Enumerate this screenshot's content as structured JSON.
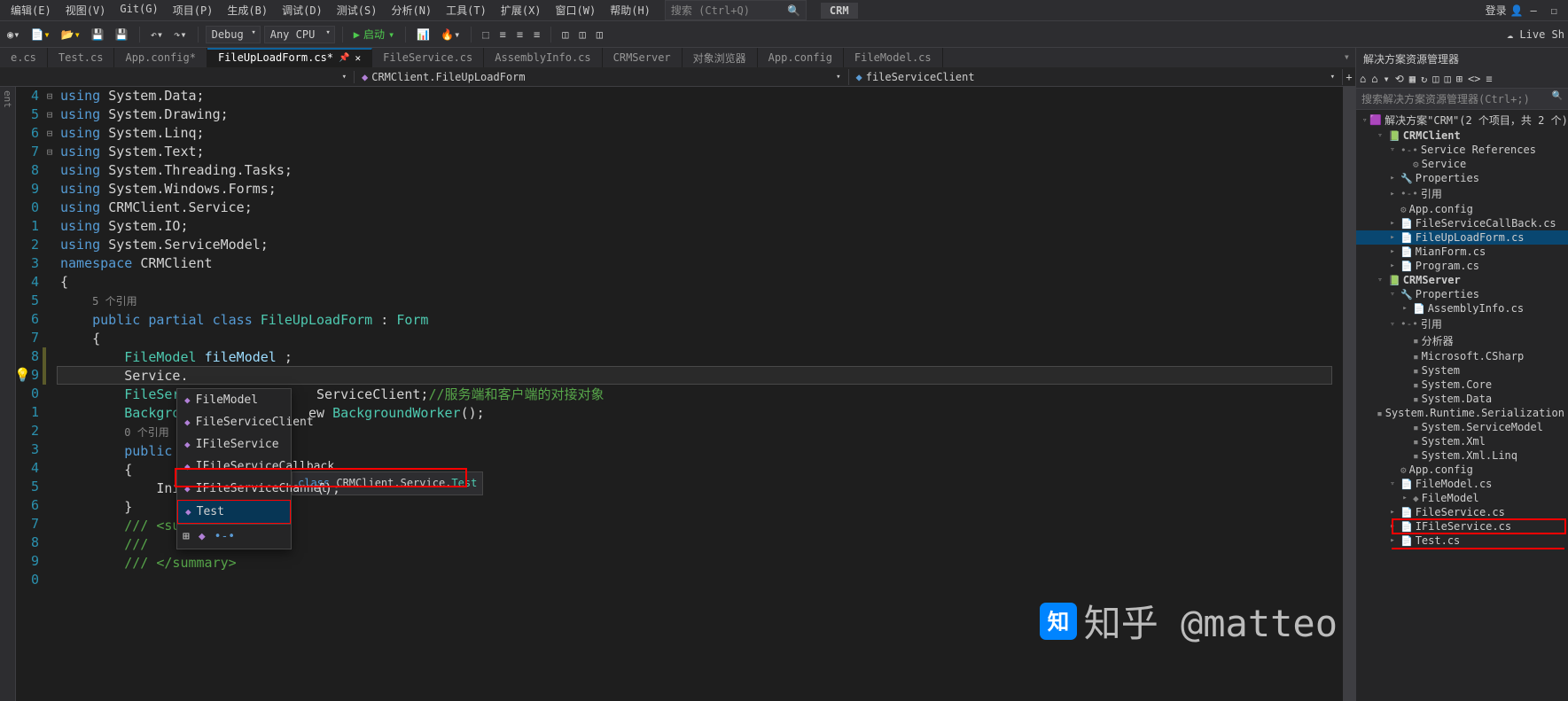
{
  "menubar": {
    "items": [
      "编辑(E)",
      "视图(V)",
      "Git(G)",
      "项目(P)",
      "生成(B)",
      "调试(D)",
      "测试(S)",
      "分析(N)",
      "工具(T)",
      "扩展(X)",
      "窗口(W)",
      "帮助(H)"
    ],
    "search_placeholder": "搜索 (Ctrl+Q)",
    "crm": "CRM",
    "login": "登录",
    "live_share": "Live Sh"
  },
  "toolbar": {
    "config": "Debug",
    "platform": "Any CPU",
    "start": "启动"
  },
  "tabs": [
    {
      "label": "e.cs",
      "active": false
    },
    {
      "label": "Test.cs",
      "active": false
    },
    {
      "label": "App.config*",
      "active": false
    },
    {
      "label": "FileUpLoadForm.cs*",
      "active": true,
      "pinned": true
    },
    {
      "label": "FileService.cs",
      "active": false
    },
    {
      "label": "AssemblyInfo.cs",
      "active": false
    },
    {
      "label": "CRMServer",
      "active": false
    },
    {
      "label": "对象浏览器",
      "active": false
    },
    {
      "label": "App.config",
      "active": false
    },
    {
      "label": "FileModel.cs",
      "active": false
    }
  ],
  "navbar": {
    "left": "",
    "middle": "CRMClient.FileUpLoadForm",
    "right": "fileServiceClient"
  },
  "code": {
    "lines": [
      "4",
      "5",
      "6",
      "7",
      "8",
      "9",
      "0",
      "1",
      "2",
      "3",
      "4",
      "5",
      "",
      "6",
      "7",
      "8",
      "9",
      "0",
      "1",
      "",
      "2",
      "3",
      "4",
      "5",
      "6",
      "7",
      "8",
      "9",
      "0"
    ],
    "refs1": "5 个引用",
    "refs2": "0 个引用",
    "comment_cn": "//服务端和客户端的对接对象",
    "current_line_text": "Service."
  },
  "intellisense": {
    "items": [
      "FileModel",
      "FileServiceClient",
      "IFileService",
      "IFileServiceCallback",
      "IFileServiceChannel",
      "Test"
    ],
    "selected_index": 5,
    "tooltip_prefix": "class ",
    "tooltip_ns": "CRMClient.Service.",
    "tooltip_sel": "Test"
  },
  "solution": {
    "title": "解决方案资源管理器",
    "search_placeholder": "搜索解决方案资源管理器(Ctrl+;)",
    "root": "解决方案\"CRM\"(2 个项目，共 2 个)",
    "tree": [
      {
        "depth": 0,
        "arrow": "▿",
        "icon": "sln",
        "label": "解决方案\"CRM\"(2 个项目，共 2 个)"
      },
      {
        "depth": 1,
        "arrow": "▿",
        "icon": "proj",
        "label": "CRMClient",
        "bold": true
      },
      {
        "depth": 2,
        "arrow": "▿",
        "icon": "ref",
        "label": "Service References"
      },
      {
        "depth": 3,
        "arrow": "",
        "icon": "svc",
        "label": "Service"
      },
      {
        "depth": 2,
        "arrow": "▸",
        "icon": "wrench",
        "label": "Properties"
      },
      {
        "depth": 2,
        "arrow": "▸",
        "icon": "ref",
        "label": "引用"
      },
      {
        "depth": 2,
        "arrow": "",
        "icon": "cfg",
        "label": "App.config"
      },
      {
        "depth": 2,
        "arrow": "▸",
        "icon": "cs",
        "label": "FileServiceCallBack.cs"
      },
      {
        "depth": 2,
        "arrow": "▸",
        "icon": "cs",
        "label": "FileUpLoadForm.cs",
        "selected": true
      },
      {
        "depth": 2,
        "arrow": "▸",
        "icon": "cs",
        "label": "MianForm.cs"
      },
      {
        "depth": 2,
        "arrow": "▸",
        "icon": "cs",
        "label": "Program.cs"
      },
      {
        "depth": 1,
        "arrow": "▿",
        "icon": "proj",
        "label": "CRMServer",
        "bold": true
      },
      {
        "depth": 2,
        "arrow": "▿",
        "icon": "wrench",
        "label": "Properties"
      },
      {
        "depth": 3,
        "arrow": "▸",
        "icon": "cs",
        "label": "AssemblyInfo.cs"
      },
      {
        "depth": 2,
        "arrow": "▿",
        "icon": "ref",
        "label": "引用"
      },
      {
        "depth": 3,
        "arrow": "",
        "icon": "dll",
        "label": "分析器"
      },
      {
        "depth": 3,
        "arrow": "",
        "icon": "dll",
        "label": "Microsoft.CSharp"
      },
      {
        "depth": 3,
        "arrow": "",
        "icon": "dll",
        "label": "System"
      },
      {
        "depth": 3,
        "arrow": "",
        "icon": "dll",
        "label": "System.Core"
      },
      {
        "depth": 3,
        "arrow": "",
        "icon": "dll",
        "label": "System.Data"
      },
      {
        "depth": 3,
        "arrow": "",
        "icon": "dll",
        "label": "System.Runtime.Serialization"
      },
      {
        "depth": 3,
        "arrow": "",
        "icon": "dll",
        "label": "System.ServiceModel"
      },
      {
        "depth": 3,
        "arrow": "",
        "icon": "dll",
        "label": "System.Xml"
      },
      {
        "depth": 3,
        "arrow": "",
        "icon": "dll",
        "label": "System.Xml.Linq"
      },
      {
        "depth": 2,
        "arrow": "",
        "icon": "cfg",
        "label": "App.config"
      },
      {
        "depth": 2,
        "arrow": "▿",
        "icon": "cs",
        "label": "FileModel.cs"
      },
      {
        "depth": 3,
        "arrow": "▸",
        "icon": "class",
        "label": "FileModel"
      },
      {
        "depth": 2,
        "arrow": "▸",
        "icon": "cs",
        "label": "FileService.cs"
      },
      {
        "depth": 2,
        "arrow": "▸",
        "icon": "cs",
        "label": "IFileService.cs",
        "redbox": true
      },
      {
        "depth": 2,
        "arrow": "▸",
        "icon": "cs",
        "label": "Test.cs"
      }
    ]
  },
  "watermark": "知乎 @matteo"
}
